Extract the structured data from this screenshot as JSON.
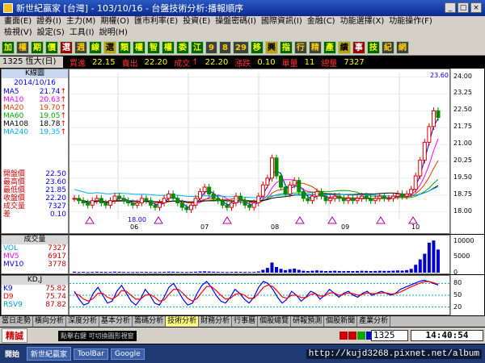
{
  "window": {
    "title": "新世紀贏家 [台灣] - 103/10/16 - 台盤技術分析:播報順序",
    "buttons": [
      "_",
      "□",
      "×"
    ]
  },
  "menu": {
    "row1": [
      "畫面(E)",
      "證券(I)",
      "主力(M)",
      "期權(O)",
      "匯市利率(E)",
      "投資(E)",
      "操盤密碼(I)",
      "國際資訊(I)",
      "金融(C)",
      "功能選擇(X)",
      "功能操作(F)"
    ],
    "row2": [
      "檢視(V)",
      "設定(S)",
      "工具(I)",
      "說明(H)"
    ]
  },
  "toolbar": {
    "buttons": [
      "加",
      "權",
      "期",
      "價",
      "選",
      "週",
      "線",
      "選",
      "類",
      "權",
      "智",
      "權",
      "委",
      "江",
      "9",
      "8",
      "29",
      "移",
      "興",
      "指",
      "行",
      "精",
      "產",
      "績",
      "事",
      "技",
      "紀",
      "網"
    ]
  },
  "quote": {
    "code": "1325 恆大(日)",
    "buy_label": "買進",
    "buy": "22.15",
    "sell_label": "賣出",
    "sell": "22.20",
    "deal_label": "成交",
    "deal_arrow": "↑",
    "deal": "22.20",
    "change_label": "漲跌",
    "change": "0.10",
    "volume_label": "單量",
    "volume": "11",
    "total_label": "總量",
    "total": "7327"
  },
  "legend": {
    "header": "K線圖",
    "date": "2014/10/16",
    "ma": [
      {
        "name": "MA5",
        "value": "21.74",
        "arrow": "↑",
        "color": "#0000ff"
      },
      {
        "name": "MA10",
        "value": "20.63",
        "arrow": "↑",
        "color": "#ff00ff"
      },
      {
        "name": "MA20",
        "value": "19.70",
        "arrow": "↑",
        "color": "#d04000"
      },
      {
        "name": "MA60",
        "value": "19.05",
        "arrow": "↑",
        "color": "#00aa00"
      },
      {
        "name": "MA108",
        "value": "18.78",
        "arrow": "↑",
        "color": "#000000"
      },
      {
        "name": "MA240",
        "value": "19.35",
        "arrow": "↑",
        "color": "#00b0ff"
      }
    ],
    "ohlc": [
      {
        "name": "開盤價",
        "value": "22.50"
      },
      {
        "name": "最高價",
        "value": "23.60"
      },
      {
        "name": "最低價",
        "value": "21.85"
      },
      {
        "name": "收盤價",
        "value": "22.20"
      },
      {
        "name": "成交量",
        "value": "7327"
      },
      {
        "name": "差",
        "value": "0.10"
      }
    ]
  },
  "chart_data": [
    {
      "type": "candlestick",
      "title": "K線圖",
      "y_ticks": [
        "24.00",
        "23.25",
        "22.50",
        "21.75",
        "21.00",
        "20.25",
        "19.50",
        "18.75",
        "18.00"
      ],
      "ylim": [
        17.7,
        24.2
      ],
      "x_tick_labels": [
        "06",
        "07",
        "08",
        "09",
        "10"
      ],
      "annotations": [
        "23.60",
        "18.00"
      ],
      "close_path": [
        18.6,
        18.5,
        18.4,
        18.3,
        18.5,
        18.6,
        18.4,
        18.3,
        18.5,
        18.7,
        18.6,
        18.5,
        18.4,
        18.3,
        18.4,
        18.6,
        18.5,
        18.3,
        18.2,
        18.4,
        18.6,
        18.8,
        18.6,
        18.4,
        18.2,
        18.1,
        18.3,
        18.6,
        18.9,
        19.1,
        18.8,
        18.6,
        18.5,
        18.3,
        18.2,
        18.4,
        18.7,
        18.5,
        18.3,
        18.2,
        18.4,
        18.7,
        19.2,
        19.5,
        20.4,
        19.6,
        19.1,
        18.8,
        19.2,
        19.4,
        18.9,
        18.6,
        18.5,
        18.7,
        18.9,
        18.7,
        18.5,
        18.6,
        18.7,
        18.6,
        18.5,
        18.6,
        18.5,
        18.6,
        18.7,
        18.6,
        18.5,
        18.6,
        18.7,
        18.6,
        18.6,
        18.7,
        18.8,
        18.7,
        18.8,
        19.0,
        19.6,
        20.3,
        21.1,
        21.8,
        22.5,
        22.2
      ]
    },
    {
      "type": "bar",
      "title": "成交量",
      "legend": [
        {
          "name": "VOL",
          "value": "7327"
        },
        {
          "name": "MV5",
          "value": "6917"
        },
        {
          "name": "MV10",
          "value": "3778"
        }
      ],
      "y_ticks": [
        "10000",
        "5000",
        "0"
      ],
      "ylim": [
        0,
        11000
      ],
      "values": [
        300,
        200,
        250,
        180,
        220,
        300,
        260,
        200,
        240,
        310,
        280,
        220,
        200,
        180,
        210,
        260,
        240,
        200,
        180,
        220,
        260,
        320,
        300,
        260,
        220,
        200,
        240,
        300,
        380,
        420,
        360,
        300,
        260,
        220,
        200,
        230,
        300,
        260,
        220,
        200,
        240,
        380,
        900,
        1500,
        3200,
        1800,
        1200,
        800,
        1100,
        1300,
        900,
        600,
        500,
        600,
        700,
        600,
        500,
        550,
        600,
        520,
        480,
        520,
        500,
        540,
        600,
        560,
        500,
        540,
        600,
        560,
        560,
        620,
        700,
        650,
        800,
        1200,
        2500,
        4200,
        6000,
        9500,
        10200,
        7327
      ]
    },
    {
      "type": "line",
      "title": "KD,J",
      "legend": [
        {
          "name": "K9",
          "value": "75.82"
        },
        {
          "name": "D9",
          "value": "75.74"
        },
        {
          "name": "RSV9",
          "value": "87.82"
        }
      ],
      "y_ticks": [
        "80",
        "50",
        "20"
      ],
      "ylim": [
        5,
        95
      ],
      "series": [
        {
          "name": "K9",
          "values": [
            60,
            40,
            25,
            30,
            55,
            70,
            50,
            30,
            35,
            60,
            75,
            55,
            35,
            25,
            40,
            65,
            50,
            30,
            25,
            45,
            70,
            80,
            60,
            40,
            25,
            30,
            55,
            75,
            85,
            70,
            50,
            35,
            30,
            45,
            65,
            55,
            40,
            30,
            45,
            70,
            85,
            80,
            65,
            45,
            30,
            40,
            60,
            50,
            35,
            45,
            60,
            55,
            40,
            50,
            65,
            55,
            45,
            55,
            60,
            50,
            45,
            55,
            60,
            50,
            55,
            60,
            55,
            50,
            55,
            65,
            70,
            75,
            80,
            85,
            88,
            85,
            80,
            76
          ]
        },
        {
          "name": "D9",
          "values": [
            55,
            50,
            40,
            35,
            42,
            55,
            55,
            45,
            40,
            48,
            62,
            60,
            50,
            40,
            40,
            50,
            52,
            45,
            35,
            38,
            52,
            65,
            65,
            55,
            42,
            35,
            42,
            58,
            72,
            72,
            62,
            50,
            40,
            42,
            52,
            55,
            50,
            42,
            42,
            55,
            70,
            76,
            72,
            60,
            46,
            42,
            50,
            50,
            44,
            44,
            52,
            54,
            48,
            48,
            56,
            56,
            50,
            52,
            56,
            54,
            50,
            52,
            56,
            54,
            54,
            56,
            56,
            53,
            54,
            58,
            64,
            70,
            75,
            80,
            84,
            85,
            82,
            78
          ]
        }
      ]
    }
  ],
  "tabs": [
    "當日走勢",
    "橫向分析",
    "深度分析",
    "基本分析",
    "籌碼分析",
    "技術分析",
    "財務分析",
    "行事曆",
    "個股總覽",
    "研報預測",
    "個股新聞",
    "產業分析"
  ],
  "active_tab": "技術分析",
  "status": {
    "mode": "精誠",
    "hint": "點擊右鍵 可切換圖形視窗",
    "code": "1325",
    "clock": "14:40:54"
  },
  "taskbar": {
    "start": "開始",
    "tasks": [
      "新世紀贏家",
      "ToolBar",
      "Google"
    ],
    "watermark": "http://kujd3268.pixnet.net/album"
  }
}
